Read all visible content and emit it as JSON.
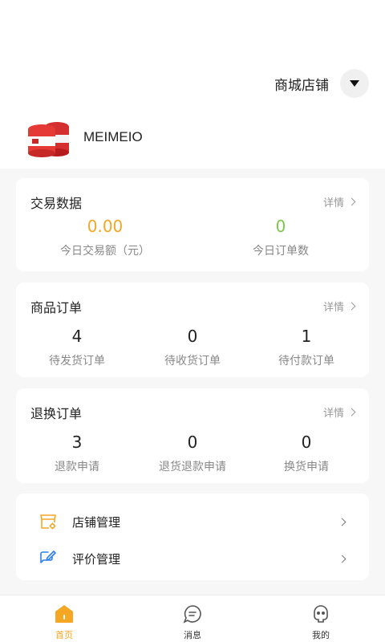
{
  "header": {
    "store_label": "商城店铺",
    "dropdown_icon": "caret-down-icon"
  },
  "shop": {
    "name": "MEIMEIO",
    "logo_icon": "shop-logo"
  },
  "trade": {
    "title": "交易数据",
    "more": "详情",
    "stats": [
      {
        "value": "0.00",
        "label": "今日交易额（元）",
        "color": "#f5a623"
      },
      {
        "value": "0",
        "label": "今日订单数",
        "color": "#7cc84f"
      }
    ]
  },
  "orders": {
    "title": "商品订单",
    "more": "详情",
    "stats": [
      {
        "value": "4",
        "label": "待发货订单"
      },
      {
        "value": "0",
        "label": "待收货订单"
      },
      {
        "value": "1",
        "label": "待付款订单"
      }
    ]
  },
  "refunds": {
    "title": "退换订单",
    "more": "详情",
    "stats": [
      {
        "value": "3",
        "label": "退款申请"
      },
      {
        "value": "0",
        "label": "退货退款申请"
      },
      {
        "value": "0",
        "label": "换货申请"
      }
    ]
  },
  "menu": [
    {
      "label": "店铺管理",
      "icon": "store-settings-icon",
      "color": "#f5a623"
    },
    {
      "label": "评价管理",
      "icon": "edit-comment-icon",
      "color": "#2f80ed"
    }
  ],
  "tabs": [
    {
      "label": "首页",
      "icon": "home-icon",
      "active": true
    },
    {
      "label": "消息",
      "icon": "message-icon",
      "active": false
    },
    {
      "label": "我的",
      "icon": "profile-icon",
      "active": false
    }
  ],
  "colors": {
    "accent": "#f5a623",
    "success": "#7cc84f",
    "brand_red": "#e53935"
  }
}
